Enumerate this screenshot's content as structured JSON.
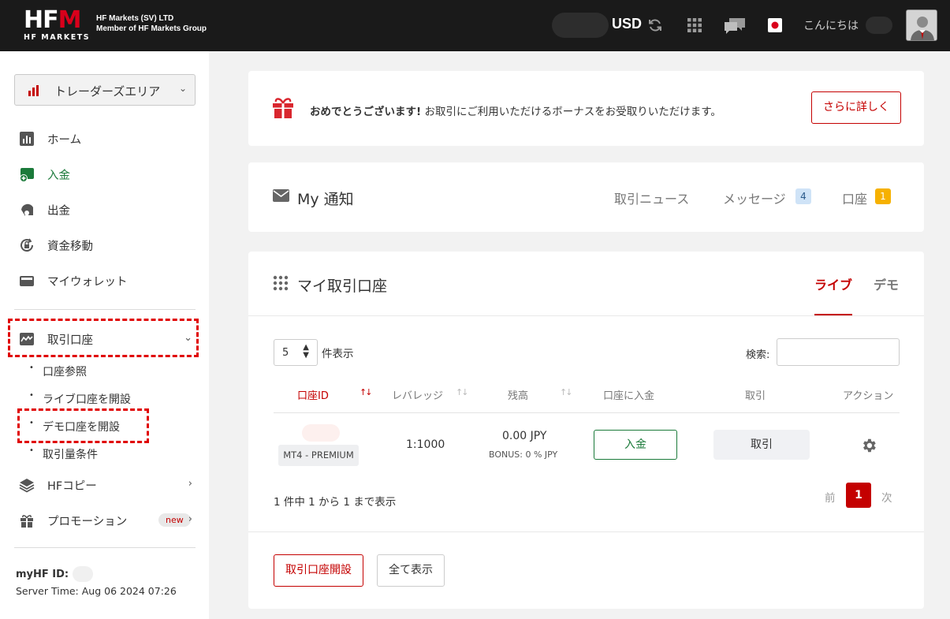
{
  "brand": {
    "logo_main": "HF",
    "logo_m": "M",
    "logo_sub": "HF MARKETS",
    "company_line1": "HF Markets (SV) LTD",
    "company_line2": "Member of HF Markets Group"
  },
  "topbar": {
    "currency": "USD",
    "greeting": "こんにちは"
  },
  "sidebar": {
    "area_select": "トレーダーズエリア",
    "items": [
      {
        "label": "ホーム"
      },
      {
        "label": "入金"
      },
      {
        "label": "出金"
      },
      {
        "label": "資金移動"
      },
      {
        "label": "マイウォレット"
      }
    ],
    "trading_accounts": "取引口座",
    "sub_items": [
      {
        "label": "口座参照"
      },
      {
        "label": "ライブ口座を開設"
      },
      {
        "label": "デモ口座を開設"
      },
      {
        "label": "取引量条件"
      }
    ],
    "hf_copy": "HFコピー",
    "promotion": "プロモーション",
    "new_badge": "new",
    "myhf_id_label": "myHF ID:",
    "server_time": "Server Time: Aug 06 2024 07:26"
  },
  "bonus": {
    "strong": "おめでとうございます!",
    "text": " お取引にご利用いただけるボーナスをお受取りいただけます。",
    "button": "さらに詳しく"
  },
  "notifications": {
    "title": "My 通知",
    "news": "取引ニュース",
    "messages": "メッセージ",
    "messages_count": "4",
    "account": "口座",
    "account_count": "1"
  },
  "accounts": {
    "title": "マイ取引口座",
    "tab_live": "ライブ",
    "tab_demo": "デモ",
    "length_value": "5",
    "length_label": "件表示",
    "search_label": "検索:",
    "columns": [
      "口座ID",
      "レバレッジ",
      "残高",
      "口座に入金",
      "取引",
      "アクション"
    ],
    "row": {
      "type": "MT4 - PREMIUM",
      "leverage": "1:1000",
      "balance": "0.00 JPY",
      "bonus": "BONUS: 0 % JPY",
      "deposit": "入金",
      "trade": "取引"
    },
    "info": "1 件中 1 から 1 まで表示",
    "prev": "前",
    "page": "1",
    "next": "次",
    "open_button": "取引口座開設",
    "all_button": "全て表示"
  },
  "colors": {
    "brand_red": "#c40000",
    "deposit_green": "#1b7a3a",
    "topbar": "#1a1a1a"
  }
}
